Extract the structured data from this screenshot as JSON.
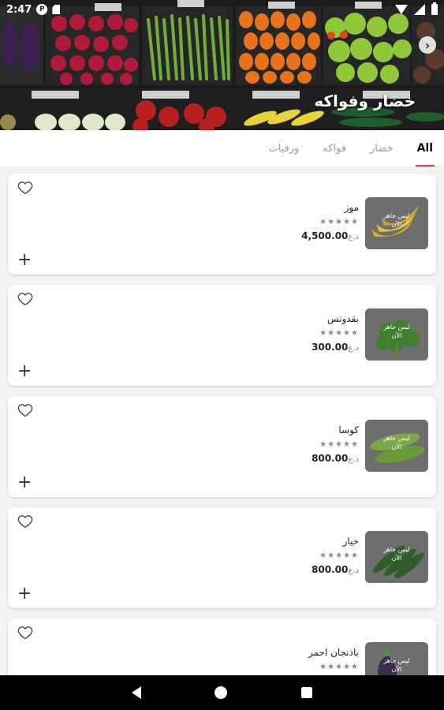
{
  "status_bar": {
    "time": "2:47",
    "badge": "P"
  },
  "hero": {
    "title": "خضار وفواكه",
    "arrow": "›"
  },
  "tabs": [
    {
      "label": "All",
      "active": true
    },
    {
      "label": "خضار",
      "active": false
    },
    {
      "label": "فواكه",
      "active": false
    },
    {
      "label": "ورقيات",
      "active": false
    }
  ],
  "products": [
    {
      "name": "موز",
      "stars": "★★★★★",
      "price": "4,500.00",
      "currency": "د.ع",
      "image_label": "ليس جاهز\nالآن",
      "image_color": "#c9a233"
    },
    {
      "name": "بقدونس",
      "stars": "★★★★★",
      "price": "300.00",
      "currency": "د.ع",
      "image_label": "ليس جاهز\nالآن",
      "image_color": "#4a8a3a"
    },
    {
      "name": "كوسا",
      "stars": "★★★★★",
      "price": "800.00",
      "currency": "د.ع",
      "image_label": "ليس جاهز\nالآن",
      "image_color": "#6e9a3e"
    },
    {
      "name": "خيار",
      "stars": "★★★★★",
      "price": "800.00",
      "currency": "د.ع",
      "image_label": "ليس جاهز\nالآن",
      "image_color": "#2f5e2a"
    },
    {
      "name": "باذنجان احمر",
      "stars": "★★★★★",
      "price": "",
      "currency": "",
      "image_label": "ليس جاهز\nالآن",
      "image_color": "#3d2a4a"
    }
  ],
  "colors": {
    "accent": "#e53935",
    "nav_bar": "#000000"
  }
}
